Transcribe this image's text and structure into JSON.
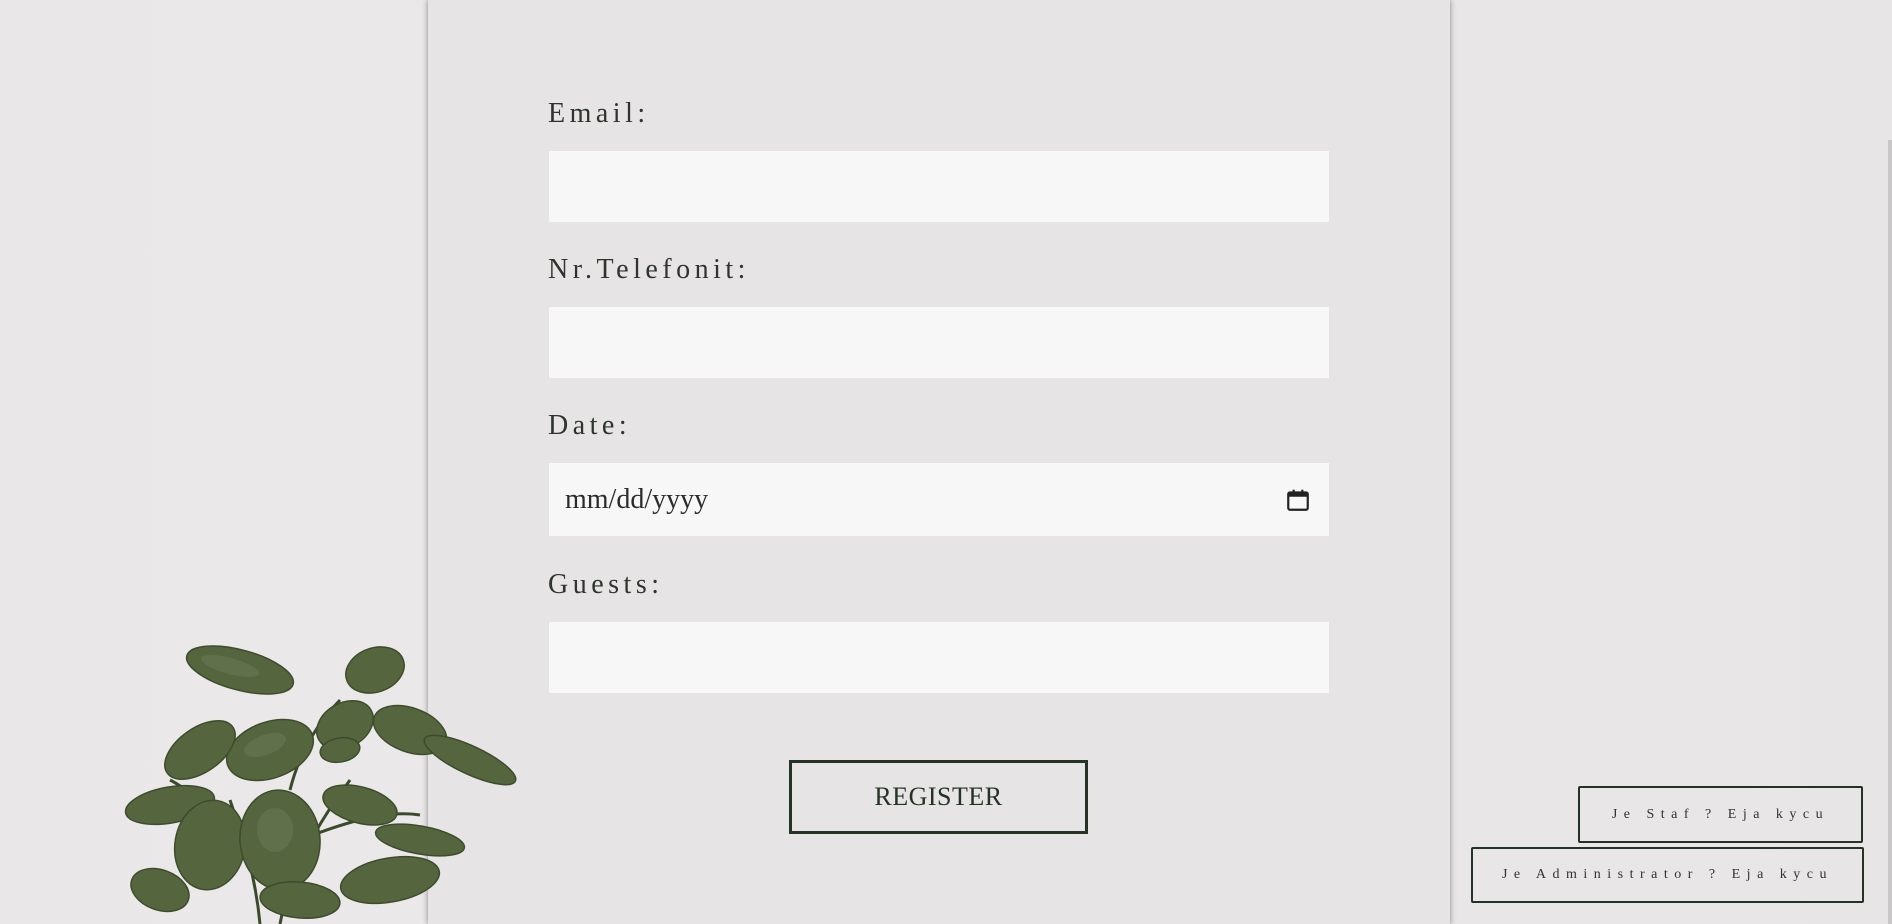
{
  "form": {
    "fields": [
      {
        "label": "Email:",
        "value": "",
        "type": "email"
      },
      {
        "label": "Nr.Telefonit:",
        "value": "",
        "type": "tel"
      },
      {
        "label": "Date:",
        "value": "mm/dd/yyyy",
        "type": "date"
      },
      {
        "label": "Guests:",
        "value": "",
        "type": "number"
      }
    ],
    "register_label": "REGISTER"
  },
  "side_links": {
    "staff_label": "Je Staf ? Eja kycu",
    "admin_label": "Je Administrator ? Eja kycu"
  },
  "icons": {
    "date_picker": "calendar-icon",
    "decoration": "plant-illustration"
  },
  "colors": {
    "accent": "#243325",
    "background": "#e8e6e6",
    "input_bg": "#f7f7f7",
    "leaf": "#4f5f3c"
  }
}
